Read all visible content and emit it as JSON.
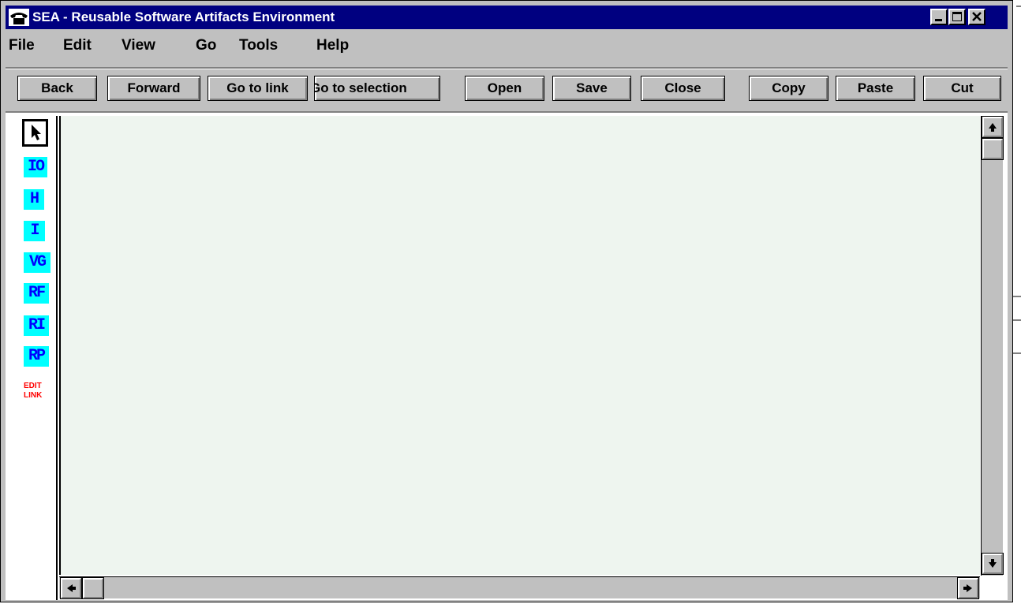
{
  "window": {
    "title": "SEA - Reusable Software Artifacts Environment",
    "controls": [
      "minimize-icon",
      "maximize-icon",
      "close-icon"
    ]
  },
  "menu": [
    "File",
    "Edit",
    "View",
    "Go",
    "Tools",
    "Help"
  ],
  "toolbar": {
    "back": "Back",
    "forward": "Forward",
    "go_to_link": "Go to link",
    "go_to_selection": "Go to selection",
    "open": "Open",
    "save": "Save",
    "close": "Close",
    "copy": "Copy",
    "paste": "Paste",
    "cut": "Cut"
  },
  "palette": {
    "select_icon": "arrow-pointer-icon",
    "tools": [
      "IO",
      "H",
      "I",
      "VG",
      "RF",
      "RI",
      "RP"
    ],
    "edit_link": [
      "EDIT",
      "LINK"
    ]
  },
  "colors": {
    "titlebar": "#000080",
    "chrome": "#c0c0c0",
    "canvas": "#eef5ef",
    "tool_bg": "#00ffff",
    "tool_fg": "#0000ff",
    "edit_link": "#ff0000"
  }
}
